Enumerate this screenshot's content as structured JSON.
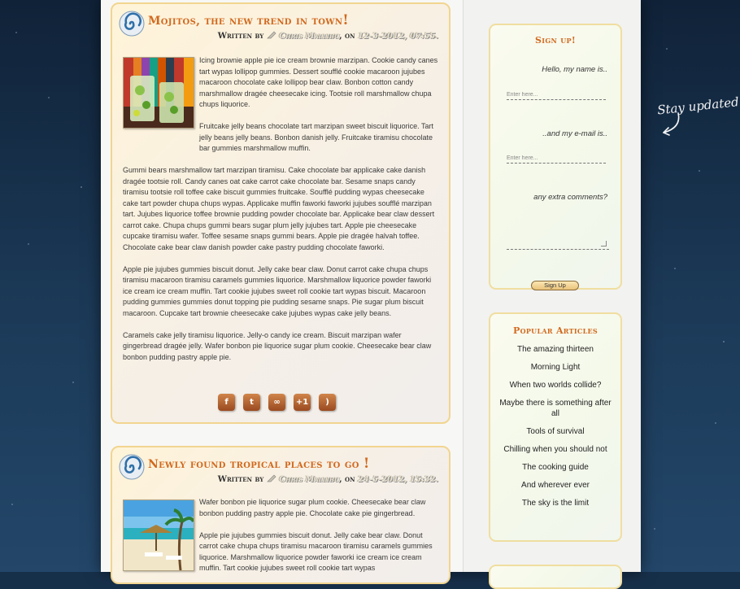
{
  "posts": [
    {
      "title": "Mojitos, the new trend in town",
      "title_bang": "!",
      "written_by": "Written by",
      "author": "Chris Mallibu",
      "on": ", on",
      "date": "12-3-2012, 07:55.",
      "thumb_icon": "mojito-glasses-image",
      "paragraphs": [
        "Icing brownie apple pie ice cream brownie marzipan. Cookie candy canes tart wypas lollipop gummies. Dessert soufflé cookie macaroon jujubes macaroon chocolate cake lollipop bear claw. Bonbon cotton candy marshmallow dragée cheesecake icing. Tootsie roll marshmallow chupa chups liquorice.",
        "Fruitcake jelly beans chocolate tart marzipan sweet biscuit liquorice. Tart jelly beans jelly beans. Bonbon danish jelly. Fruitcake tiramisu chocolate bar gummies marshmallow muffin.",
        "Gummi bears marshmallow tart marzipan tiramisu. Cake chocolate bar applicake cake danish dragée tootsie roll. Candy canes oat cake carrot cake chocolate bar. Sesame snaps candy tiramisu tootsie roll toffee cake biscuit gummies fruitcake. Soufflé pudding wypas cheesecake cake tart powder chupa chups wypas. Applicake muffin faworki faworki jujubes soufflé marzipan tart. Jujubes liquorice toffee brownie pudding powder chocolate bar. Applicake bear claw dessert carrot cake. Chupa chups gummi bears sugar plum jelly jujubes tart. Apple pie cheesecake cupcake tiramisu wafer. Toffee sesame snaps gummi bears. Apple pie dragée halvah toffee. Chocolate cake bear claw danish powder cake pastry pudding chocolate faworki.",
        "Apple pie jujubes gummies biscuit donut. Jelly cake bear claw. Donut carrot cake chupa chups tiramisu macaroon tiramisu caramels gummies liquorice. Marshmallow liquorice powder faworki ice cream ice cream muffin. Tart cookie jujubes sweet roll cookie tart wypas biscuit. Macaroon pudding gummies gummies donut topping pie pudding sesame snaps. Pie sugar plum biscuit macaroon. Cupcake tart brownie cheesecake cake jujubes wypas cake jelly beans.",
        "Caramels cake jelly tiramisu liquorice. Jelly-o candy ice cream. Biscuit marzipan wafer gingerbread dragée jelly. Wafer bonbon pie liquorice sugar plum cookie. Cheesecake bear claw bonbon pudding pastry apple pie."
      ],
      "share_buttons": [
        {
          "icon": "facebook-icon",
          "glyph": "f"
        },
        {
          "icon": "twitter-icon",
          "glyph": "t"
        },
        {
          "icon": "link-icon",
          "glyph": "∞"
        },
        {
          "icon": "google-plus-icon",
          "glyph": "+1"
        },
        {
          "icon": "rss-icon",
          "glyph": ")"
        }
      ]
    },
    {
      "title": "Newly found tropical places to go",
      "title_bang": "!",
      "written_by": "Written by",
      "author": "Chris Mallibu",
      "on": ", on",
      "date": "24-5-2012, 15:32.",
      "thumb_icon": "tropical-beach-image",
      "paragraphs": [
        "Wafer bonbon pie liquorice sugar plum cookie. Cheesecake bear claw bonbon pudding pastry apple pie. Chocolate cake pie gingerbread.",
        "Apple pie jujubes gummies biscuit donut. Jelly cake bear claw. Donut carrot cake chupa chups tiramisu macaroon tiramisu caramels gummies liquorice. Marshmallow liquorice powder faworki ice cream ice cream muffin. Tart cookie jujubes sweet roll cookie tart wypas"
      ]
    }
  ],
  "signup": {
    "title": "Sign up",
    "title_bang": "!",
    "name_label": "Hello, my name is..",
    "name_placeholder": "Enter here...",
    "email_label": "..and my e-mail is..",
    "email_placeholder": "Enter here...",
    "comments_label": "any extra comments?",
    "button_label": "Sign Up"
  },
  "popular": {
    "title": "Popular Articles",
    "items": [
      "The amazing thirteen",
      "Morning Light",
      "When two worlds collide?",
      "Maybe there is something after all",
      "Tools of survival",
      "Chilling when you should not",
      "The cooking guide",
      "And wherever ever",
      "The sky is the limit"
    ]
  },
  "stay_updated": "Stay updated!",
  "colors": {
    "accent": "#d2691e",
    "sky": "#17304a",
    "post_border": "#f1d590"
  }
}
